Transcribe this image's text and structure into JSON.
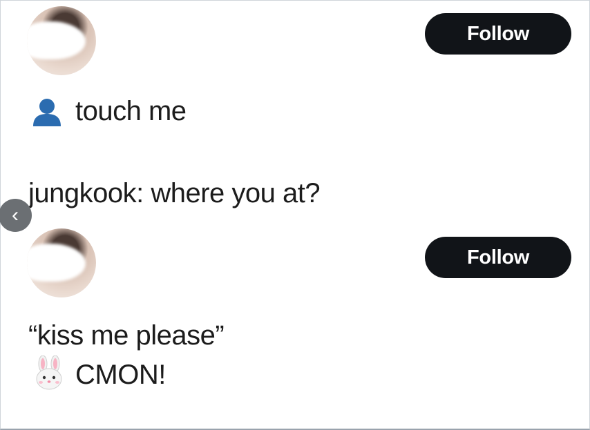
{
  "post1": {
    "follow_label": "Follow",
    "text": "touch me",
    "icon": "bust-in-silhouette-icon"
  },
  "middle_text": "jungkook: where you at?",
  "post2": {
    "follow_label": "Follow",
    "quote": "“kiss me please”",
    "line2": "CMON!",
    "icon": "rabbit-face-icon"
  },
  "nav": {
    "prev_icon": "chevron-left-icon",
    "prev_glyph": "‹"
  },
  "colors": {
    "button_bg": "#111418",
    "person_icon": "#2b6cb0"
  }
}
